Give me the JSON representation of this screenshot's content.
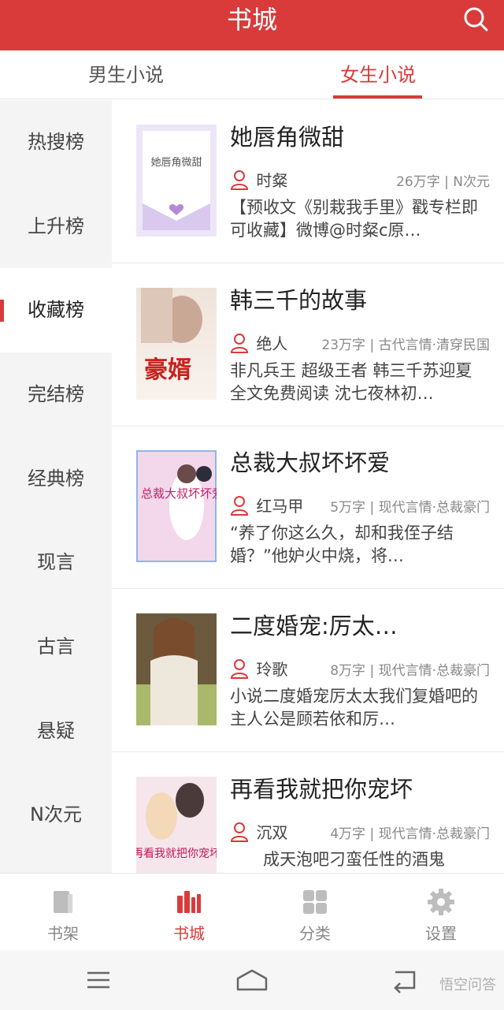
{
  "header": {
    "title": "书城"
  },
  "tabs": [
    {
      "label": "男生小说"
    },
    {
      "label": "女生小说"
    }
  ],
  "sidebar": {
    "items": [
      {
        "label": "热搜榜"
      },
      {
        "label": "上升榜"
      },
      {
        "label": "收藏榜"
      },
      {
        "label": "完结榜"
      },
      {
        "label": "经典榜"
      },
      {
        "label": "现言"
      },
      {
        "label": "古言"
      },
      {
        "label": "悬疑"
      },
      {
        "label": "N次元"
      }
    ],
    "active_index": 2
  },
  "books": [
    {
      "title": "她唇角微甜",
      "author": "时粲",
      "info": "26万字 | N次元",
      "desc": "【预收文《别栽我手里》戳专栏即可收藏】微博@时粲c原…",
      "cover_text": "她唇角微甜"
    },
    {
      "title": "韩三千的故事",
      "author": "绝人",
      "info": "23万字 | 古代言情·清穿民国",
      "desc": "非凡兵王 超级王者 韩三千苏迎夏全文免费阅读 沈七夜林初…",
      "cover_text": "豪婿"
    },
    {
      "title": "总裁大叔坏坏爱",
      "author": "红马甲",
      "info": "5万字 | 现代言情·总裁豪门",
      "desc": "“养了你这么久，却和我侄子结婚？”他妒火中烧，将…",
      "cover_text": "总裁大叔坏坏爱"
    },
    {
      "title": "二度婚宠:厉太…",
      "author": "玲歌",
      "info": "8万字 | 现代言情·总裁豪门",
      "desc": "小说二度婚宠厉太太我们复婚吧的主人公是顾若依和厉…",
      "cover_text": ""
    },
    {
      "title": "再看我就把你宠坏",
      "author": "沉双",
      "info": "4万字 | 现代言情·总裁豪门",
      "desc": "成天泡吧刁蛮任性的酒鬼",
      "cover_text": "再看我就把你宠坏"
    }
  ],
  "bottom_nav": [
    {
      "label": "书架",
      "icon": "bookshelf-icon"
    },
    {
      "label": "书城",
      "icon": "bookstore-icon"
    },
    {
      "label": "分类",
      "icon": "category-icon"
    },
    {
      "label": "设置",
      "icon": "settings-icon"
    }
  ],
  "watermark": "悟空问答",
  "colors": {
    "accent": "#d93a3a",
    "sidebar_bg": "#f4f4f4",
    "muted": "#888888"
  }
}
